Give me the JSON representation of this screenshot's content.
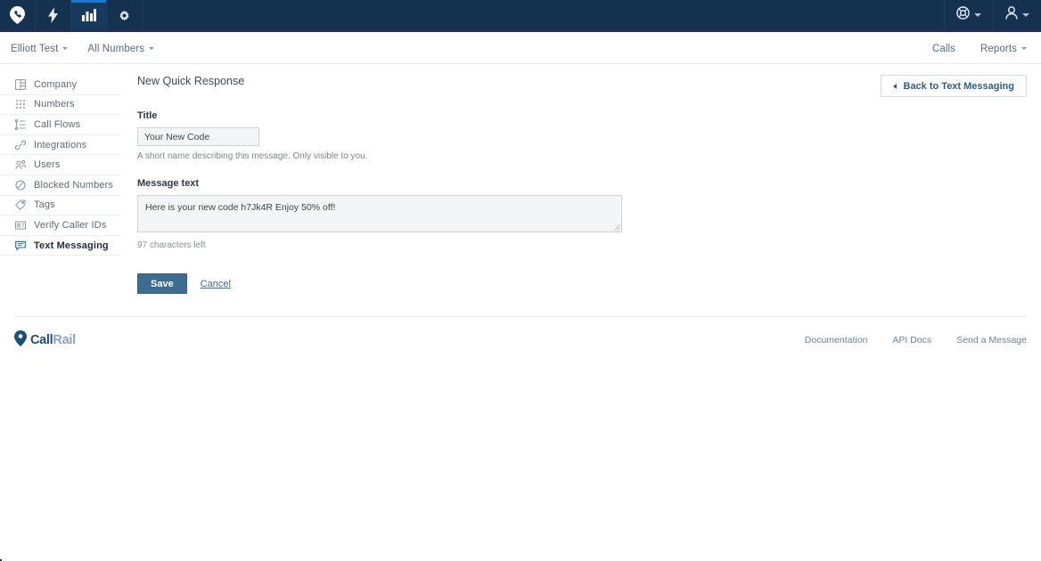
{
  "topnav": {
    "tabs": [
      {
        "name": "callrail-logo-tab",
        "icon": "phone-pin-icon",
        "active": false
      },
      {
        "name": "bolt-tab",
        "icon": "lightning-bolt-icon",
        "active": false
      },
      {
        "name": "analytics-tab",
        "icon": "bar-chart-icon",
        "active": true
      },
      {
        "name": "settings-tab",
        "icon": "gear-icon",
        "active": false
      }
    ],
    "right": [
      {
        "name": "help-menu",
        "icon": "lifebuoy-icon"
      },
      {
        "name": "account-menu",
        "icon": "user-icon"
      }
    ]
  },
  "subheader": {
    "account": "Elliott Test",
    "numbers": "All Numbers",
    "calls": "Calls",
    "reports": "Reports"
  },
  "sidebar": {
    "items": [
      {
        "label": "Company",
        "icon": "building-icon",
        "active": false
      },
      {
        "label": "Numbers",
        "icon": "keypad-icon",
        "active": false
      },
      {
        "label": "Call Flows",
        "icon": "flow-list-icon",
        "active": false
      },
      {
        "label": "Integrations",
        "icon": "link-icon",
        "active": false
      },
      {
        "label": "Users",
        "icon": "users-icon",
        "active": false
      },
      {
        "label": "Blocked Numbers",
        "icon": "block-circle-icon",
        "active": false
      },
      {
        "label": "Tags",
        "icon": "tag-icon",
        "active": false
      },
      {
        "label": "Verify Caller IDs",
        "icon": "id-card-icon",
        "active": false
      },
      {
        "label": "Text Messaging",
        "icon": "chat-bubble-icon",
        "active": true
      }
    ]
  },
  "main": {
    "page_title": "New Quick Response",
    "back_button": "Back to Text Messaging",
    "title_label": "Title",
    "title_value": "Your New Code",
    "title_placeholder": "",
    "title_help": "A short name describing this message. Only visible to you.",
    "message_label": "Message text",
    "message_value": "Here is your new code h7Jk4R Enjoy 50% off!",
    "message_placeholder": "",
    "characters_left": "97 characters left",
    "save_label": "Save",
    "cancel_label": "Cancel"
  },
  "footer": {
    "logo_first": "Call",
    "logo_second": "Rail",
    "links": [
      "Documentation",
      "API Docs",
      "Send a Message"
    ]
  },
  "colors": {
    "navy": "#14314f",
    "active_tab_accent": "#1b78d0",
    "sidebar_accent": "#2c6896",
    "primary_button": "#3d6c91",
    "link_blue": "#2e5d87",
    "footer_link": "#6b8296"
  }
}
